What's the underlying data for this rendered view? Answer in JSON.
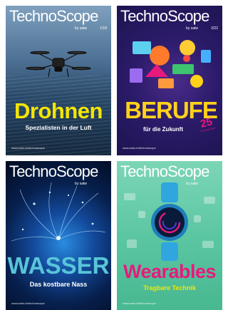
{
  "covers": [
    {
      "brand": "TechnoScope",
      "by": "by satw",
      "issue": "1/18",
      "title": "Drohnen",
      "subtitle": "Spezialisten in der Luft",
      "url": "www.satw.ch/technoscope",
      "image": "drone-icon",
      "title_color": "#f3e600"
    },
    {
      "brand": "TechnoScope",
      "by": "by satw",
      "issue": "2/22",
      "title": "BERUFE",
      "subtitle": "für die Zukunft",
      "url": "www.satw.ch/technoscope",
      "badge": {
        "number": "25",
        "label": "TechnoScope"
      },
      "image": "professions-icons",
      "title_color": "#ffd21a"
    },
    {
      "brand": "TechnoScope",
      "by": "by satw",
      "title": "WASSER",
      "subtitle": "Das kostbare Nass",
      "url": "www.satw.ch/technoscope",
      "image": "water-splash-icon",
      "title_color": "#58c5d8"
    },
    {
      "brand": "TechnoScope",
      "by": "by satw",
      "title": "Wearables",
      "subtitle": "Tragbare Technik",
      "url": "www.satw.ch/technoscope",
      "image": "smartwatch-icon",
      "title_color": "#e8197d"
    }
  ]
}
